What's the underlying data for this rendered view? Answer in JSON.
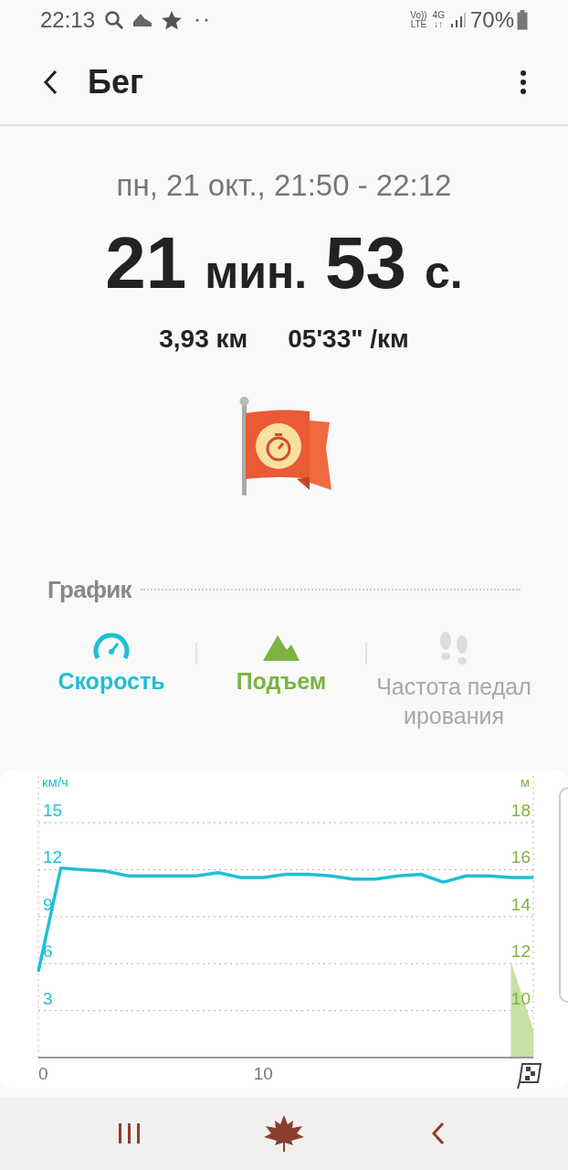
{
  "status_bar": {
    "time": "22:13",
    "network_top": "Vo))",
    "network_bottom": "LTE",
    "data_top": "4G",
    "data_bottom": "↓↑",
    "battery": "70%"
  },
  "header": {
    "title": "Бег"
  },
  "summary": {
    "date_range": "пн, 21 окт., 21:50 - 22:12",
    "duration_minutes": "21",
    "minutes_unit": "мин.",
    "duration_seconds": "53",
    "seconds_unit": "с.",
    "distance": "3,93 км",
    "pace": "05'33\" /км"
  },
  "section": {
    "title": "График"
  },
  "tabs": [
    {
      "kind": "speed",
      "label": "Скорость",
      "color": "#1fbfd4",
      "disabled": false
    },
    {
      "kind": "elevation",
      "label": "Подъем",
      "color": "#7cb342",
      "disabled": false
    },
    {
      "kind": "cadence",
      "label": "Частота педал ирования",
      "color": "#a8a8a8",
      "disabled": true
    }
  ],
  "chart": {
    "speed": {
      "unit": "км/ч",
      "chart_data": {
        "type": "line",
        "x": [
          0,
          1,
          2,
          3,
          4,
          5,
          6,
          7,
          8,
          9,
          10,
          11,
          12,
          13,
          14,
          15,
          16,
          17,
          18,
          19,
          20,
          21,
          22
        ],
        "xlim": [
          0,
          22
        ],
        "xticks": [
          0,
          10
        ],
        "ylim": [
          0,
          15
        ],
        "yticks": [
          3,
          6,
          9,
          12,
          15
        ],
        "grid": true,
        "series": [
          {
            "color": "#1fbfd4",
            "values": [
              5.5,
              12.1,
              12.0,
              11.9,
              11.6,
              11.6,
              11.6,
              11.6,
              11.8,
              11.5,
              11.5,
              11.7,
              11.7,
              11.6,
              11.4,
              11.4,
              11.6,
              11.7,
              11.2,
              11.6,
              11.6,
              11.5,
              11.5
            ]
          }
        ]
      }
    },
    "elevation": {
      "unit": "м",
      "chart_data": {
        "type": "area",
        "x": [
          21,
          22
        ],
        "xlim": [
          0,
          22
        ],
        "ylim": [
          8,
          18
        ],
        "yticks": [
          10,
          12,
          14,
          16,
          18
        ],
        "series": [
          {
            "color": "#c5e1a5",
            "values": [
              12.1,
              9.2
            ]
          }
        ]
      }
    }
  }
}
